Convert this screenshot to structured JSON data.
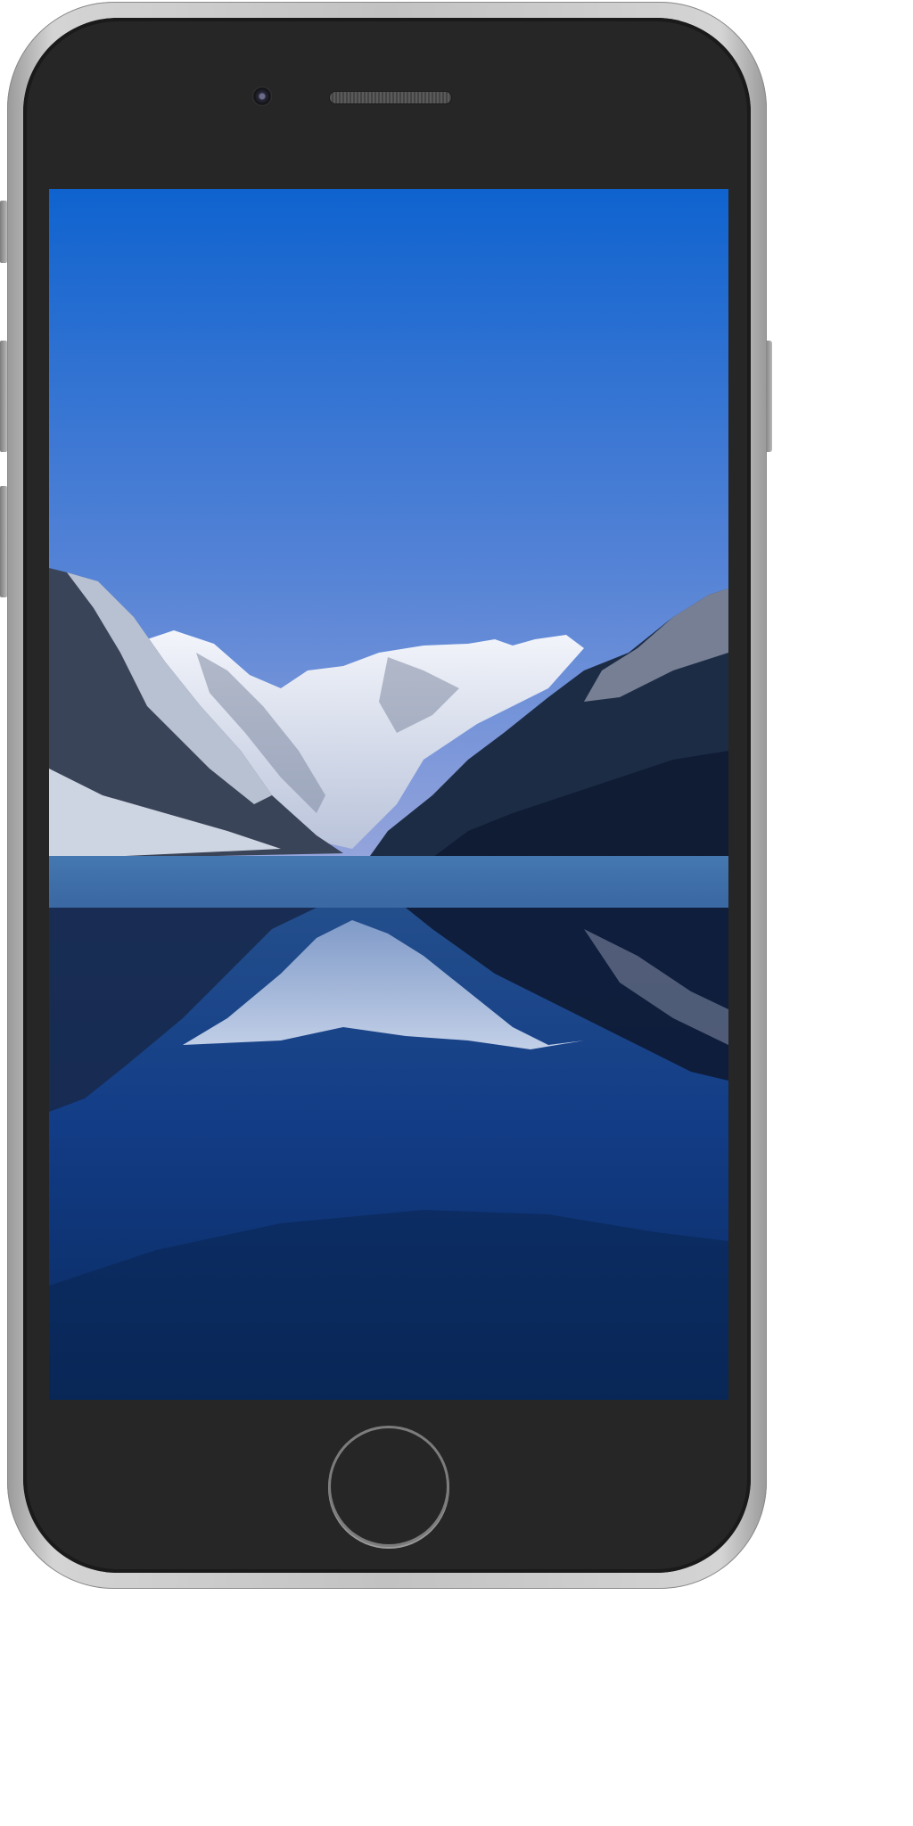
{
  "device": {
    "type": "smartphone",
    "frame_color": "#c2c2c2",
    "face_color": "#262626"
  },
  "screen": {
    "content": "wallpaper-image",
    "colors": {
      "sky_top": "#0f63cf",
      "sky_bottom": "#8aa0da",
      "water": "#0f3270"
    }
  },
  "icons": {
    "camera": "camera-icon",
    "speaker": "speaker-grille-icon",
    "home": "home-button-icon"
  }
}
